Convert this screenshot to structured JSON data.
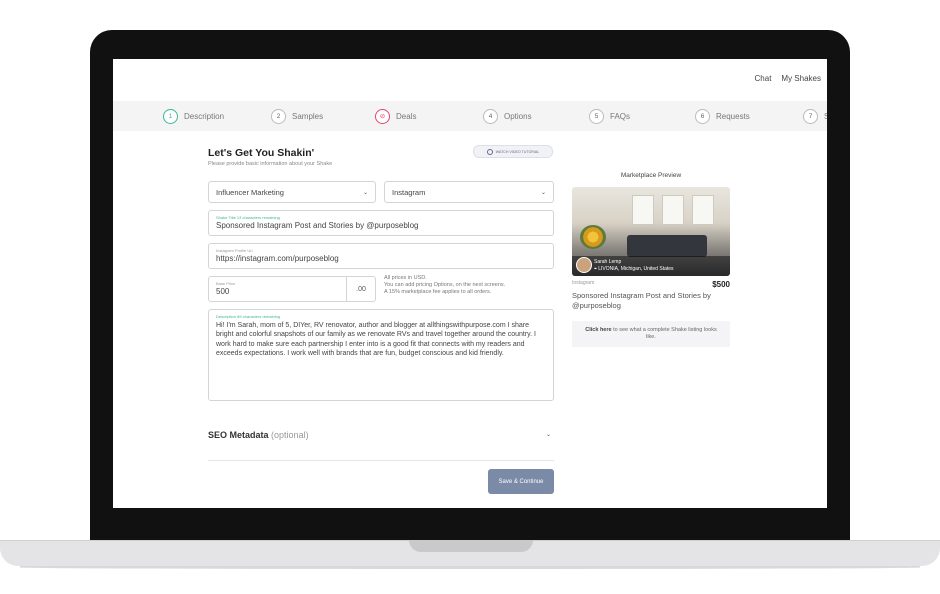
{
  "nav": {
    "chat": "Chat",
    "my_shakes": "My Shakes"
  },
  "steps": [
    {
      "num": "1",
      "label": "Description"
    },
    {
      "num": "2",
      "label": "Samples"
    },
    {
      "num": "",
      "label": "Deals"
    },
    {
      "num": "4",
      "label": "Options"
    },
    {
      "num": "5",
      "label": "FAQs"
    },
    {
      "num": "6",
      "label": "Requests"
    },
    {
      "num": "7",
      "label": "S"
    }
  ],
  "form": {
    "title": "Let's Get You Shakin'",
    "subtitle": "Please provide basic information about your Shake",
    "video_button": "WATCH VIDEO TUTORIAL",
    "category": "Influencer Marketing",
    "platform": "Instagram",
    "shake_title_label": "Shake Title 13 characters remaining",
    "shake_title": "Sponsored Instagram Post and Stories by @purposeblog",
    "profile_label": "Instagram Profile Url",
    "profile_url": "https://instagram.com/purposeblog",
    "price_label": "Base Price",
    "price": "500",
    "cents": ".00",
    "price_note_1": "All prices in USD.",
    "price_note_2": "You can add pricing Options, on the next screens.",
    "price_note_3": "A 15% marketplace fee applies to all orders.",
    "desc_label": "Description 89 characters remaining",
    "description": "Hi! I'm Sarah, mom of 5, DIYer, RV renovator, author and blogger at allthingswithpurpose.com I share bright and colorful snapshots of our family as we renovate RVs and travel together around the country. I work hard to make sure each partnership I enter into is a good fit that connects with my readers and exceeds expectations. I work well with brands that are fun, budget conscious and kid friendly.",
    "seo_title": "SEO Metadata",
    "seo_optional": "(optional)",
    "save_button": "Save & Continue"
  },
  "preview": {
    "title": "Marketplace Preview",
    "name": "Sarah Lemp",
    "location": "LIVONIA, Michigan, United States",
    "category": "Instagram",
    "price": "$500",
    "listing_title": "Sponsored Instagram Post and Stories by @purposeblog",
    "cta_bold": "Click here",
    "cta_text": "to see what a complete Shake listing looks like."
  },
  "colors": {
    "accent_green": "#3ab795",
    "deals_red": "#e2456d",
    "save_button": "#7a8aa7"
  }
}
